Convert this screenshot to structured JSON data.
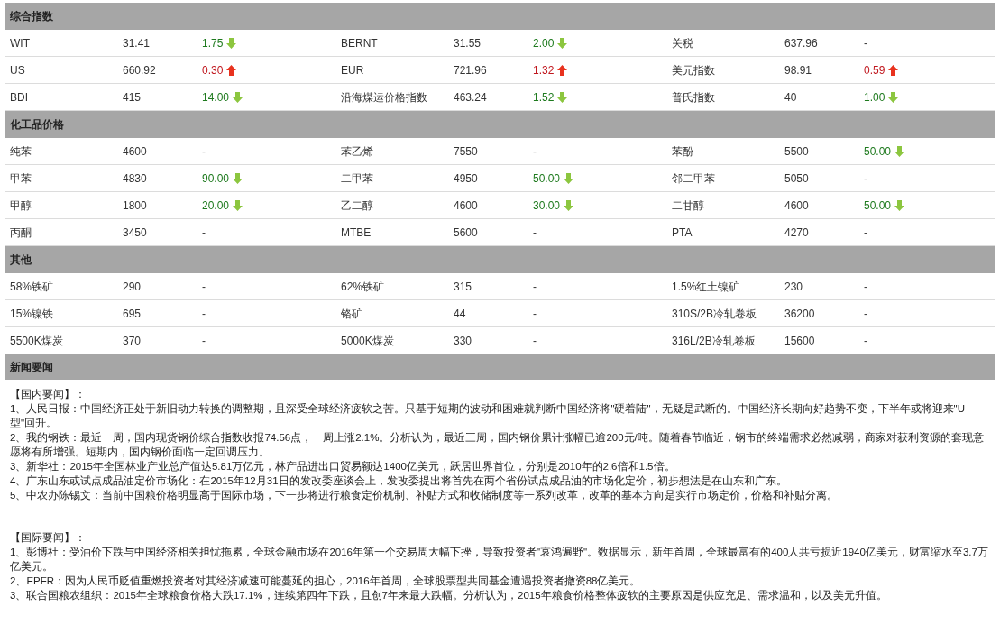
{
  "sections": [
    {
      "title": "综合指数",
      "rows": [
        [
          {
            "name": "WIT",
            "value": "31.41",
            "change": "1.75",
            "kind": "down"
          },
          {
            "name": "BERNT",
            "value": "31.55",
            "change": "2.00",
            "kind": "down"
          },
          {
            "name": "关税",
            "value": "637.96",
            "change": "-",
            "kind": "flat"
          }
        ],
        [
          {
            "name": "US",
            "value": "660.92",
            "change": "0.30",
            "kind": "up"
          },
          {
            "name": "EUR",
            "value": "721.96",
            "change": "1.32",
            "kind": "up"
          },
          {
            "name": "美元指数",
            "value": "98.91",
            "change": "0.59",
            "kind": "up"
          }
        ],
        [
          {
            "name": "BDI",
            "value": "415",
            "change": "14.00",
            "kind": "down"
          },
          {
            "name": "沿海煤运价格指数",
            "value": "463.24",
            "change": "1.52",
            "kind": "down"
          },
          {
            "name": "普氏指数",
            "value": "40",
            "change": "1.00",
            "kind": "down"
          }
        ]
      ]
    },
    {
      "title": "化工品价格",
      "rows": [
        [
          {
            "name": "纯苯",
            "value": "4600",
            "change": "-",
            "kind": "flat"
          },
          {
            "name": "苯乙烯",
            "value": "7550",
            "change": "-",
            "kind": "flat"
          },
          {
            "name": "苯酚",
            "value": "5500",
            "change": "50.00",
            "kind": "down"
          }
        ],
        [
          {
            "name": "甲苯",
            "value": "4830",
            "change": "90.00",
            "kind": "down"
          },
          {
            "name": "二甲苯",
            "value": "4950",
            "change": "50.00",
            "kind": "down"
          },
          {
            "name": "邻二甲苯",
            "value": "5050",
            "change": "-",
            "kind": "flat"
          }
        ],
        [
          {
            "name": "甲醇",
            "value": "1800",
            "change": "20.00",
            "kind": "down"
          },
          {
            "name": "乙二醇",
            "value": "4600",
            "change": "30.00",
            "kind": "down"
          },
          {
            "name": "二甘醇",
            "value": "4600",
            "change": "50.00",
            "kind": "down"
          }
        ],
        [
          {
            "name": "丙酮",
            "value": "3450",
            "change": "-",
            "kind": "flat"
          },
          {
            "name": "MTBE",
            "value": "5600",
            "change": "-",
            "kind": "flat"
          },
          {
            "name": "PTA",
            "value": "4270",
            "change": "-",
            "kind": "flat"
          }
        ]
      ]
    },
    {
      "title": "其他",
      "rows": [
        [
          {
            "name": "58%铁矿",
            "value": "290",
            "change": "-",
            "kind": "flat"
          },
          {
            "name": "62%铁矿",
            "value": "315",
            "change": "-",
            "kind": "flat"
          },
          {
            "name": "1.5%红土镍矿",
            "value": "230",
            "change": "-",
            "kind": "flat"
          }
        ],
        [
          {
            "name": "15%镍铁",
            "value": "695",
            "change": "-",
            "kind": "flat"
          },
          {
            "name": "铬矿",
            "value": "44",
            "change": "-",
            "kind": "flat"
          },
          {
            "name": "310S/2B冷轧卷板",
            "value": "36200",
            "change": "-",
            "kind": "flat"
          }
        ],
        [
          {
            "name": "5500K煤炭",
            "value": "370",
            "change": "-",
            "kind": "flat"
          },
          {
            "name": "5000K煤炭",
            "value": "330",
            "change": "-",
            "kind": "flat"
          },
          {
            "name": "316L/2B冷轧卷板",
            "value": "15600",
            "change": "-",
            "kind": "flat"
          }
        ]
      ]
    }
  ],
  "news": {
    "title": "新闻要闻",
    "groups": [
      {
        "heading": "【国内要闻】：",
        "items": [
          "1、人民日报：中国经济正处于新旧动力转换的调整期，且深受全球经济疲软之苦。只基于短期的波动和困难就判断中国经济将\"硬着陆\"，无疑是武断的。中国经济长期向好趋势不变，下半年或将迎来\"U型\"回升。",
          "2、我的钢铁：最近一周，国内现货钢价综合指数收报74.56点，一周上涨2.1%。分析认为，最近三周，国内钢价累计涨幅已逾200元/吨。随着春节临近，钢市的终端需求必然减弱，商家对获利资源的套现意愿将有所增强。短期内，国内钢价面临一定回调压力。",
          "3、新华社：2015年全国林业产业总产值达5.81万亿元，林产品进出口贸易额达1400亿美元，跃居世界首位，分别是2010年的2.6倍和1.5倍。",
          "4、广东山东或试点成品油定价市场化：在2015年12月31日的发改委座谈会上，发改委提出将首先在两个省份试点成品油的市场化定价，初步想法是在山东和广东。",
          "5、中农办陈锡文：当前中国粮价格明显高于国际市场，下一步将进行粮食定价机制、补贴方式和收储制度等一系列改革，改革的基本方向是实行市场定价，价格和补贴分离。"
        ]
      },
      {
        "heading": "【国际要闻】：",
        "items": [
          "1、彭博社：受油价下跌与中国经济相关担忧拖累，全球金融市场在2016年第一个交易周大幅下挫，导致投资者\"哀鸿遍野\"。数据显示，新年首周，全球最富有的400人共亏损近1940亿美元，财富缩水至3.7万亿美元。",
          "2、EPFR：因为人民币贬值重燃投资者对其经济减速可能蔓延的担心，2016年首周，全球股票型共同基金遭遇投资者撤资88亿美元。",
          "3、联合国粮农组织：2015年全球粮食价格大跌17.1%，连续第四年下跌，且创7年来最大跌幅。分析认为，2015年粮食价格整体疲软的主要原因是供应充足、需求温和，以及美元升值。"
        ]
      }
    ]
  }
}
